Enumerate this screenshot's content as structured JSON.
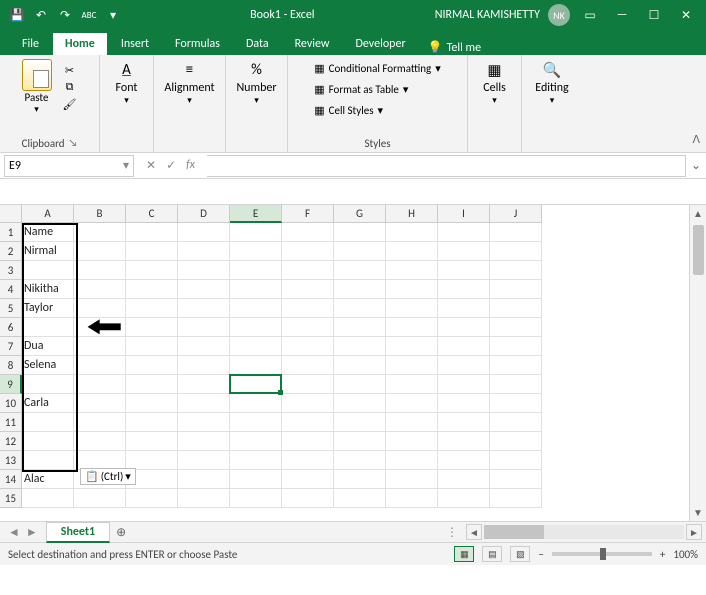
{
  "titlebar": {
    "book_title": "Book1 - Excel",
    "user_name": "NIRMAL KAMISHETTY",
    "user_initials": "NK"
  },
  "tabs": {
    "file": "File",
    "home": "Home",
    "insert": "Insert",
    "formulas": "Formulas",
    "data": "Data",
    "review": "Review",
    "developer": "Developer",
    "tellme": "Tell me"
  },
  "ribbon": {
    "paste": "Paste",
    "clipboard": "Clipboard",
    "font": "Font",
    "alignment": "Alignment",
    "number": "Number",
    "cond_format": "Conditional Formatting",
    "format_table": "Format as Table",
    "cell_styles": "Cell Styles",
    "styles": "Styles",
    "cells": "Cells",
    "editing": "Editing"
  },
  "formula_bar": {
    "name_box": "E9",
    "fx": "fx",
    "value": ""
  },
  "cols": [
    "A",
    "B",
    "C",
    "D",
    "E",
    "F",
    "G",
    "H",
    "I",
    "J"
  ],
  "rows": [
    "1",
    "2",
    "3",
    "4",
    "5",
    "6",
    "7",
    "8",
    "9",
    "10",
    "11",
    "12",
    "13",
    "14",
    "15"
  ],
  "colA": [
    "Name",
    "Nirmal",
    "",
    "Nikitha",
    "Taylor",
    "",
    "Dua",
    "Selena",
    "",
    "Carla",
    "",
    "",
    "",
    "Alac",
    ""
  ],
  "selected_col_index": 4,
  "selected_row_index": 8,
  "ctrl_chip": "(Ctrl)",
  "sheet": {
    "name": "Sheet1"
  },
  "status": {
    "msg": "Select destination and press ENTER or choose Paste",
    "zoom": "100%"
  }
}
